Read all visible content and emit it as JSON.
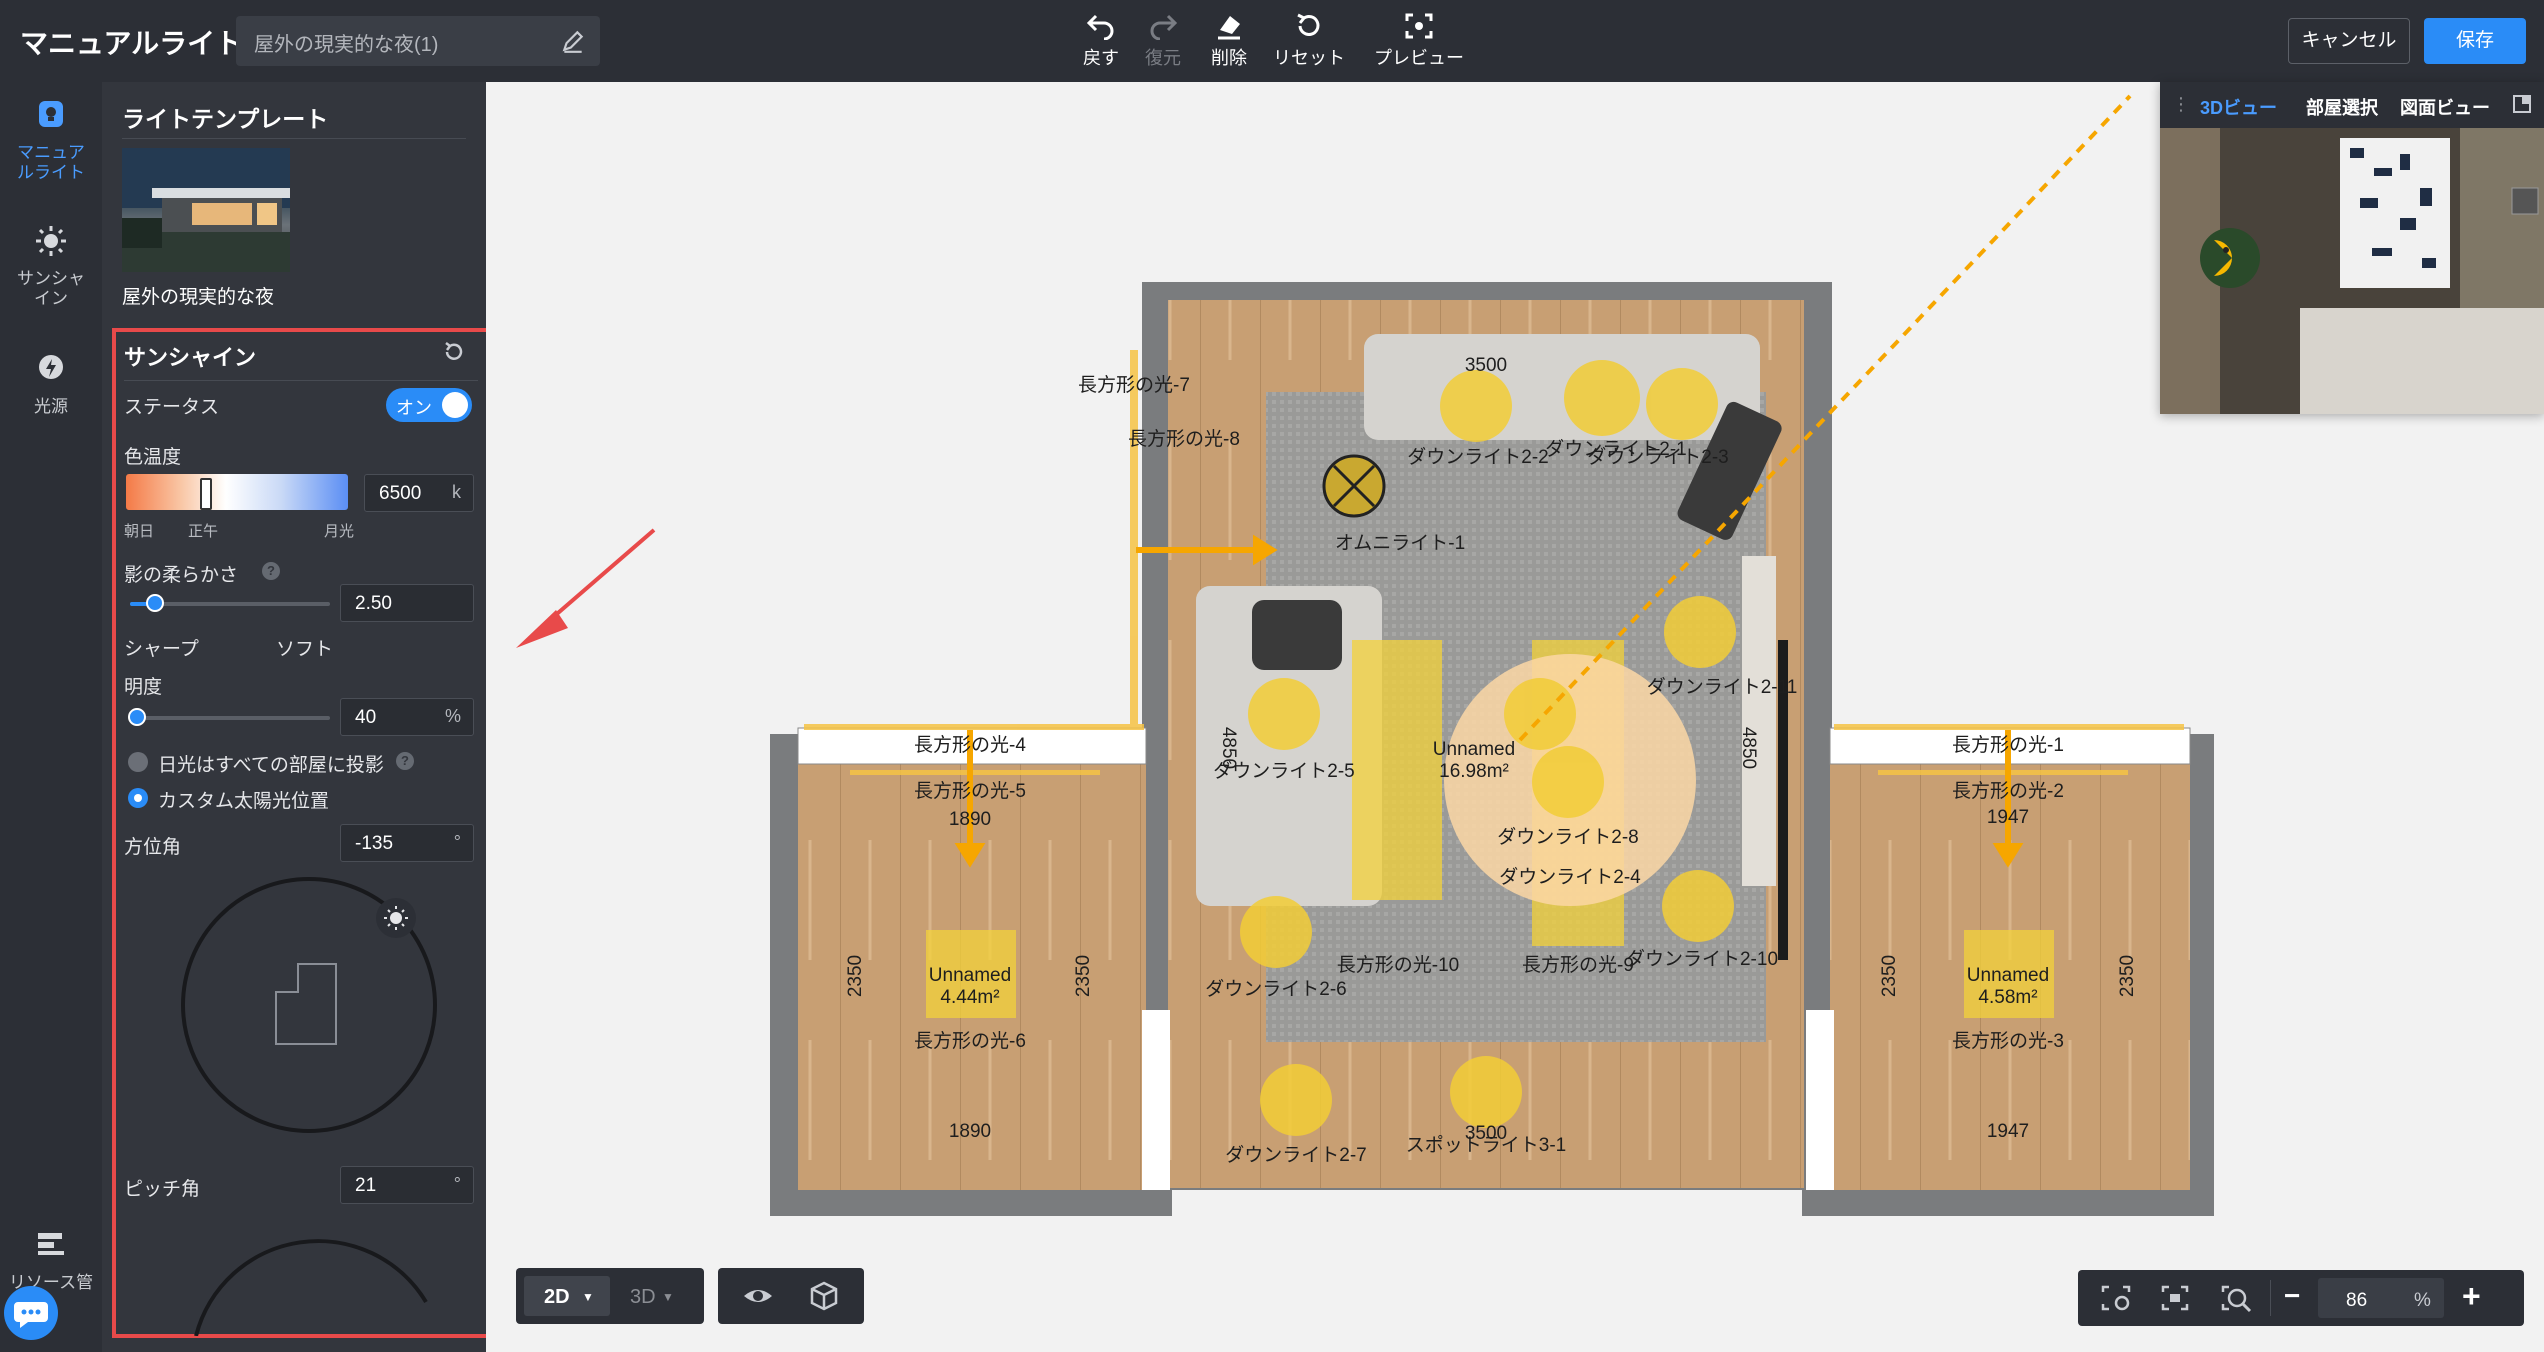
{
  "app": {
    "title": "マニュアルライト",
    "scene_name": "屋外の現実的な夜(1)"
  },
  "toolbar": {
    "undo": "戻す",
    "redo": "復元",
    "delete": "削除",
    "reset": "リセット",
    "preview": "プレビュー",
    "cancel": "キャンセル",
    "save": "保存"
  },
  "sidebar": {
    "items": [
      {
        "label": "マニュアルライト",
        "icon": "bulb-icon",
        "active": true
      },
      {
        "label": "サンシャイン",
        "icon": "sun-icon",
        "active": false
      },
      {
        "label": "光源",
        "icon": "light-source-icon",
        "active": false
      },
      {
        "label": "リソース管",
        "icon": "resource-icon",
        "active": false
      }
    ]
  },
  "templates": {
    "title": "ライトテンプレート",
    "items": [
      {
        "label": "屋外の現実的な夜"
      }
    ]
  },
  "sunshine": {
    "title": "サンシャイン",
    "status_label": "ステータス",
    "status_value": "オン",
    "color_temp_label": "色温度",
    "color_temp_value": "6500",
    "color_temp_unit": "k",
    "color_temp_marks": [
      "朝日",
      "正午",
      "月光"
    ],
    "softness_label": "影の柔らかさ",
    "softness_value": "2.50",
    "softness_fraction": 0.12,
    "softness_marks": [
      "シャープ",
      "ソフト"
    ],
    "brightness_label": "明度",
    "brightness_value": "40",
    "brightness_unit": "%",
    "brightness_fraction": 0.0,
    "option_all_rooms": "日光はすべての部屋に投影",
    "option_custom": "カスタム太陽光位置",
    "azimuth_label": "方位角",
    "azimuth_value": "-135",
    "azimuth_unit": "°",
    "pitch_label": "ピッチ角",
    "pitch_value": "21",
    "pitch_unit": "°"
  },
  "floorplan": {
    "rooms": [
      {
        "name": "Unnamed",
        "area": "16.98m²"
      },
      {
        "name": "Unnamed",
        "area": "4.44m²"
      },
      {
        "name": "Unnamed",
        "area": "4.58m²"
      }
    ],
    "dimensions": [
      "3500",
      "3500",
      "4850",
      "4850",
      "1890",
      "1890",
      "1947",
      "1947",
      "2350",
      "2350",
      "2350",
      "2350"
    ],
    "lights": [
      "長方形の光-7",
      "長方形の光-8",
      "ダウンライト2-2",
      "ダウンライト2-3",
      "ダウンライト2-1",
      "オムニライト-1",
      "ダウンライト2-11",
      "ダウンライト2-5",
      "長方形の光-4",
      "長方形の光-5",
      "長方形の光-1",
      "長方形の光-2",
      "ダウンライト2-8",
      "ダウンライト2-4",
      "長方形の光-10",
      "長方形の光-9",
      "ダウンライト2-10",
      "ダウンライト2-6",
      "長方形の光-6",
      "長方形の光-3",
      "ダウンライト2-7",
      "スポットライト3-1"
    ]
  },
  "minimap": {
    "tabs": [
      "3Dビュー",
      "部屋選択",
      "図面ビュー"
    ],
    "active_tab": "3Dビュー"
  },
  "bottom": {
    "view2d": "2D",
    "view3d": "3D",
    "zoom": "86",
    "zoom_unit": "%"
  }
}
